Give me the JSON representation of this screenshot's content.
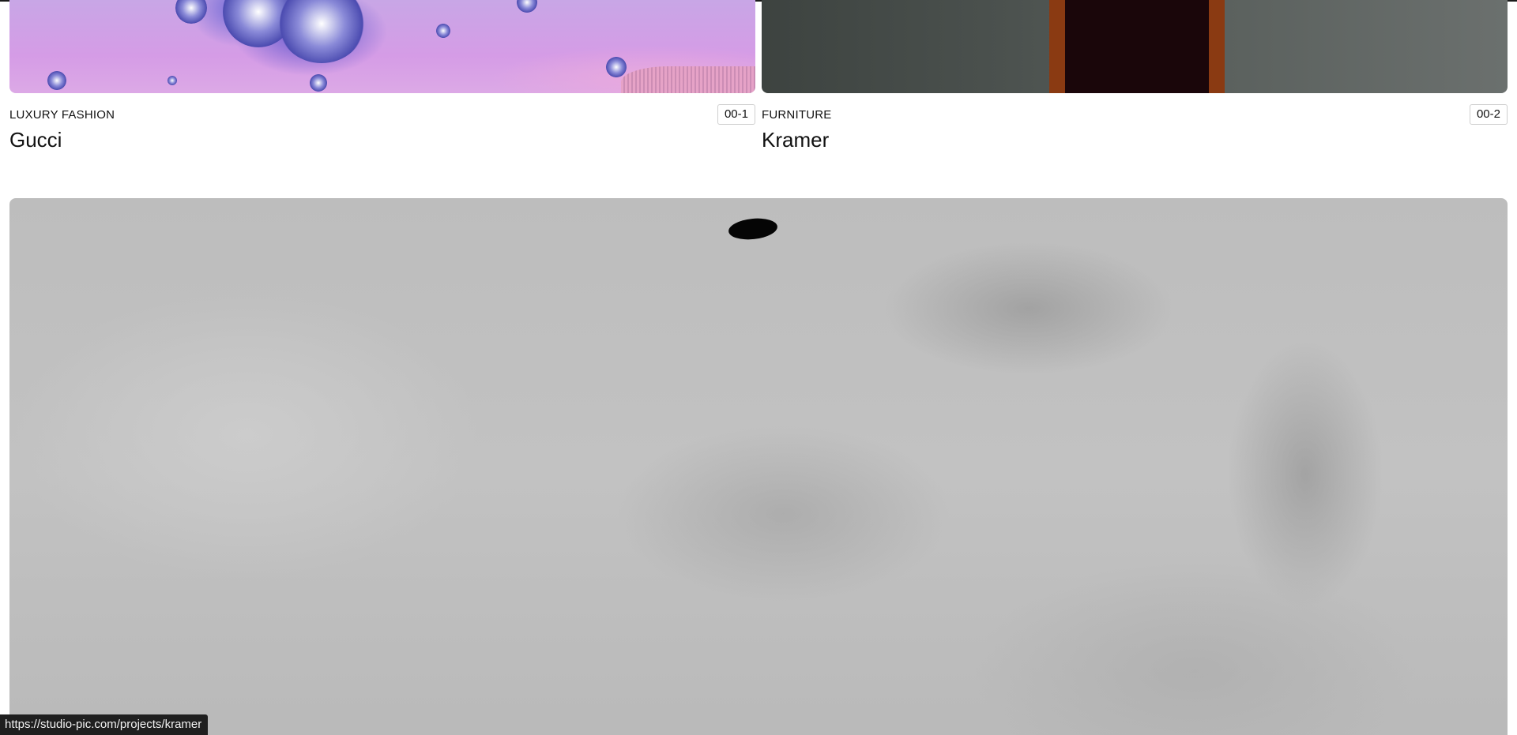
{
  "projects": [
    {
      "category": "LUXURY FASHION",
      "index": "00-1",
      "title": "Gucci"
    },
    {
      "category": "FURNITURE",
      "index": "00-2",
      "title": "Kramer"
    }
  ],
  "status_bar": {
    "url": "https://studio-pic.com/projects/kramer"
  },
  "colors": {
    "text": "#111111",
    "badge_border": "#cfcfcf",
    "status_bg": "#1f1f1f",
    "gucci_thumb": "#d59ce6",
    "feature_bg": "#c0c0c0"
  }
}
